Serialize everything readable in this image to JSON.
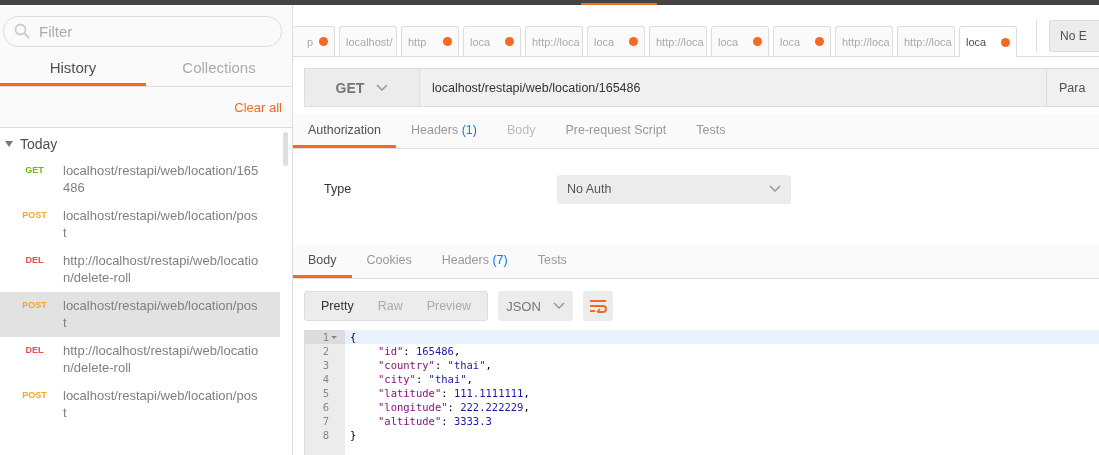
{
  "sidebar": {
    "filter": {
      "placeholder": "Filter"
    },
    "tabs": [
      {
        "label": "History",
        "selected": true
      },
      {
        "label": "Collections",
        "selected": false
      }
    ],
    "clear_all": "Clear all",
    "group": {
      "label": "Today",
      "expanded": true
    },
    "items": [
      {
        "method": "GET",
        "url": "localhost/restapi/web/location/165486",
        "selected": false
      },
      {
        "method": "POST",
        "url": "localhost/restapi/web/location/post",
        "selected": false
      },
      {
        "method": "DEL",
        "url": "http://localhost/restapi/web/location/delete-roll",
        "selected": false
      },
      {
        "method": "POST",
        "url": "localhost/restapi/web/location/post",
        "selected": true
      },
      {
        "method": "DEL",
        "url": "http://localhost/restapi/web/location/delete-roll",
        "selected": false
      },
      {
        "method": "POST",
        "url": "localhost/restapi/web/location/post",
        "selected": false
      }
    ]
  },
  "request_tabs": [
    {
      "label": "p",
      "unsaved": true,
      "selected": false
    },
    {
      "label": "localhost/",
      "unsaved": false,
      "selected": false
    },
    {
      "label": "http",
      "unsaved": true,
      "selected": false
    },
    {
      "label": "loca",
      "unsaved": true,
      "selected": false
    },
    {
      "label": "http://loca",
      "unsaved": false,
      "selected": false
    },
    {
      "label": "loca",
      "unsaved": true,
      "selected": false
    },
    {
      "label": "http://loca",
      "unsaved": false,
      "selected": false
    },
    {
      "label": "loca",
      "unsaved": true,
      "selected": false
    },
    {
      "label": "loca",
      "unsaved": true,
      "selected": false
    },
    {
      "label": "http://loca",
      "unsaved": false,
      "selected": false
    },
    {
      "label": "http://loca",
      "unsaved": false,
      "selected": false
    },
    {
      "label": "loca",
      "unsaved": true,
      "selected": true
    }
  ],
  "environment": "No E",
  "request": {
    "method": "GET",
    "url": "localhost/restapi/web/location/165486",
    "params": "Para"
  },
  "request_sections": [
    {
      "label": "Authorization",
      "selected": true,
      "disabled": false
    },
    {
      "label": "Headers",
      "count": "(1)",
      "selected": false,
      "disabled": false
    },
    {
      "label": "Body",
      "selected": false,
      "disabled": true
    },
    {
      "label": "Pre-request Script",
      "selected": false,
      "disabled": false
    },
    {
      "label": "Tests",
      "selected": false,
      "disabled": false
    }
  ],
  "auth": {
    "label": "Type",
    "value": "No Auth"
  },
  "response_sections": [
    {
      "label": "Body",
      "selected": true
    },
    {
      "label": "Cookies",
      "selected": false
    },
    {
      "label": "Headers",
      "count": "(7)",
      "selected": false
    },
    {
      "label": "Tests",
      "selected": false
    }
  ],
  "view_modes": [
    {
      "label": "Pretty",
      "selected": true
    },
    {
      "label": "Raw",
      "selected": false
    },
    {
      "label": "Preview",
      "selected": false
    }
  ],
  "format": "JSON",
  "code": [
    {
      "number": "1",
      "fold": true,
      "indent": false,
      "tokens": [
        {
          "kind": "punct",
          "text": "{"
        }
      ]
    },
    {
      "number": "2",
      "fold": false,
      "indent": true,
      "tokens": [
        {
          "kind": "key",
          "text": "\"id\""
        },
        {
          "kind": "punct",
          "text": ": "
        },
        {
          "kind": "number",
          "text": "165486"
        },
        {
          "kind": "punct",
          "text": ","
        }
      ]
    },
    {
      "number": "3",
      "fold": false,
      "indent": true,
      "tokens": [
        {
          "kind": "key",
          "text": "\"country\""
        },
        {
          "kind": "punct",
          "text": ": "
        },
        {
          "kind": "string",
          "text": "\"thai\""
        },
        {
          "kind": "punct",
          "text": ","
        }
      ]
    },
    {
      "number": "4",
      "fold": false,
      "indent": true,
      "tokens": [
        {
          "kind": "key",
          "text": "\"city\""
        },
        {
          "kind": "punct",
          "text": ": "
        },
        {
          "kind": "string",
          "text": "\"thai\""
        },
        {
          "kind": "punct",
          "text": ","
        }
      ]
    },
    {
      "number": "5",
      "fold": false,
      "indent": true,
      "tokens": [
        {
          "kind": "key",
          "text": "\"latitude\""
        },
        {
          "kind": "punct",
          "text": ": "
        },
        {
          "kind": "number",
          "text": "111.1111111"
        },
        {
          "kind": "punct",
          "text": ","
        }
      ]
    },
    {
      "number": "6",
      "fold": false,
      "indent": true,
      "tokens": [
        {
          "kind": "key",
          "text": "\"longitude\""
        },
        {
          "kind": "punct",
          "text": ": "
        },
        {
          "kind": "number",
          "text": "222.222229"
        },
        {
          "kind": "punct",
          "text": ","
        }
      ]
    },
    {
      "number": "7",
      "fold": false,
      "indent": true,
      "tokens": [
        {
          "kind": "key",
          "text": "\"altitude\""
        },
        {
          "kind": "punct",
          "text": ": "
        },
        {
          "kind": "number",
          "text": "3333.3"
        }
      ]
    },
    {
      "number": "8",
      "fold": false,
      "indent": false,
      "tokens": [
        {
          "kind": "punct",
          "text": "}"
        }
      ]
    }
  ]
}
